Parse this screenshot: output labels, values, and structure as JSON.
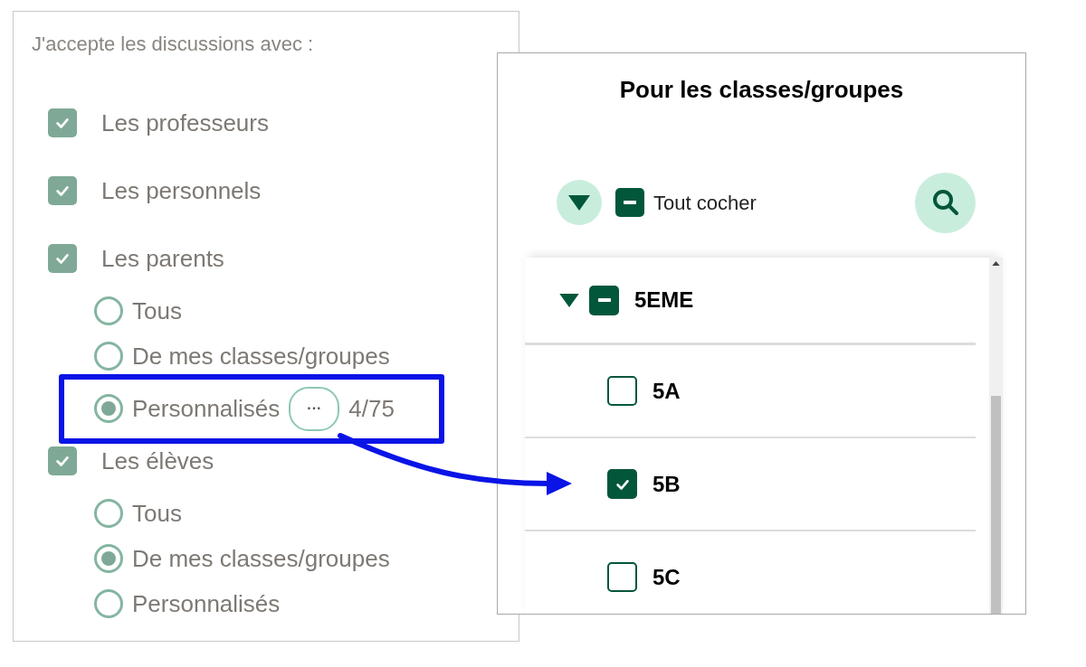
{
  "left_panel": {
    "title": "J'accepte les discussions avec :",
    "groups": [
      {
        "label": "Les professeurs",
        "checked": true
      },
      {
        "label": "Les personnels",
        "checked": true
      },
      {
        "label": "Les parents",
        "checked": true,
        "options": [
          {
            "label": "Tous",
            "selected": false
          },
          {
            "label": "De mes classes/groupes",
            "selected": false
          },
          {
            "label": "Personnalisés",
            "selected": true,
            "more_button": "···",
            "count": "4/75",
            "highlighted": true
          }
        ]
      },
      {
        "label": "Les élèves",
        "checked": true,
        "options": [
          {
            "label": "Tous",
            "selected": false
          },
          {
            "label": "De mes classes/groupes",
            "selected": true
          },
          {
            "label": "Personnalisés",
            "selected": false
          }
        ]
      }
    ]
  },
  "right_panel": {
    "title": "Pour les classes/groupes",
    "toolbar": {
      "expanded": true,
      "check_all": {
        "label": "Tout cocher",
        "partial": true
      }
    },
    "tree": [
      {
        "label": "5EME",
        "expanded": true,
        "partial": true,
        "children": [
          {
            "label": "5A",
            "checked": false
          },
          {
            "label": "5B",
            "checked": true
          },
          {
            "label": "5C",
            "checked": false
          }
        ]
      }
    ]
  }
}
